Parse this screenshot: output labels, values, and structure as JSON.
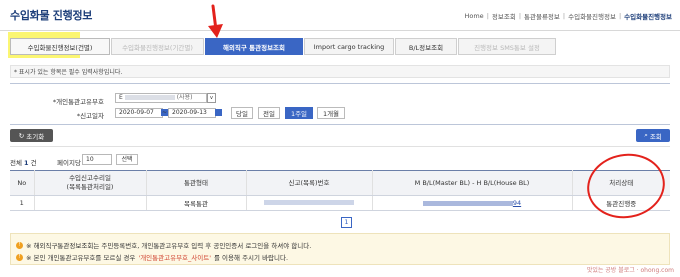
{
  "page": {
    "title": "수입화물 진행정보"
  },
  "breadcrumb": [
    "Home",
    "정보조회",
    "통관물류정보",
    "수입화물진행정보",
    "수입화물진행정보"
  ],
  "tabs": [
    {
      "label": "수입화물진행정보(건별)",
      "state": "normal"
    },
    {
      "label": "수입화물진행정보(기간별)",
      "state": "disabled"
    },
    {
      "label": "해외직구 통관정보조회",
      "state": "active"
    },
    {
      "label": "Import cargo tracking",
      "state": "normal"
    },
    {
      "label": "B/L정보조회",
      "state": "normal"
    },
    {
      "label": "진행정보 SMS통보 설정",
      "state": "disabled"
    }
  ],
  "notice": "* 표시가 있는 항목은 필수 입력사항입니다.",
  "form": {
    "customs_code_label": "*개인통관고유부호",
    "customs_code_prefix": "E",
    "customs_code_suffix": "(사용)",
    "mini_select": "v",
    "date_label": "*신고일자",
    "date_from": "2020-09-07",
    "date_tilde": "~",
    "date_to": "2020-09-13",
    "periods": [
      "당일",
      "전일",
      "1주일",
      "1개월"
    ],
    "active_period": "1주일"
  },
  "actions": {
    "reset_label": "초기화",
    "search_label": "조회"
  },
  "results": {
    "total_label": "전체",
    "total_count": "1",
    "total_unit": "건",
    "per_page_label": "페이지당",
    "per_page_value": "10",
    "per_page_btn": "선택"
  },
  "table": {
    "headers": [
      "No",
      "수입신고수리일\n(목록통관처리일)",
      "통관형태",
      "신고(목록)번호",
      "M B/L(Master BL) - H B/L(House BL)",
      "처리상태"
    ],
    "rows": [
      {
        "no": "1",
        "date": "",
        "type": "목록통관",
        "number": "",
        "bl_suffix": "94",
        "status": "통관진행중"
      }
    ]
  },
  "pagination": {
    "current": "1"
  },
  "footer_notes": {
    "line1": "※ 해외직구통관정보조회는 주민등록번호, 개인통관고유부호 입력 후 공인인증서 로그인을 하셔야 합니다.",
    "line2_prefix": "※ 본인 개인통관고유부호를 모르실 경우",
    "line2_link": "'개인통관고유부호_사이트'",
    "line2_suffix": "를 이용해 주시기 바랍니다."
  },
  "watermark": "맛있는 공방 블로그 · ohong.com",
  "annotation_colors": {
    "highlight": "#fbf56a",
    "circle": "#e3221c",
    "arrow": "#e3221c"
  }
}
